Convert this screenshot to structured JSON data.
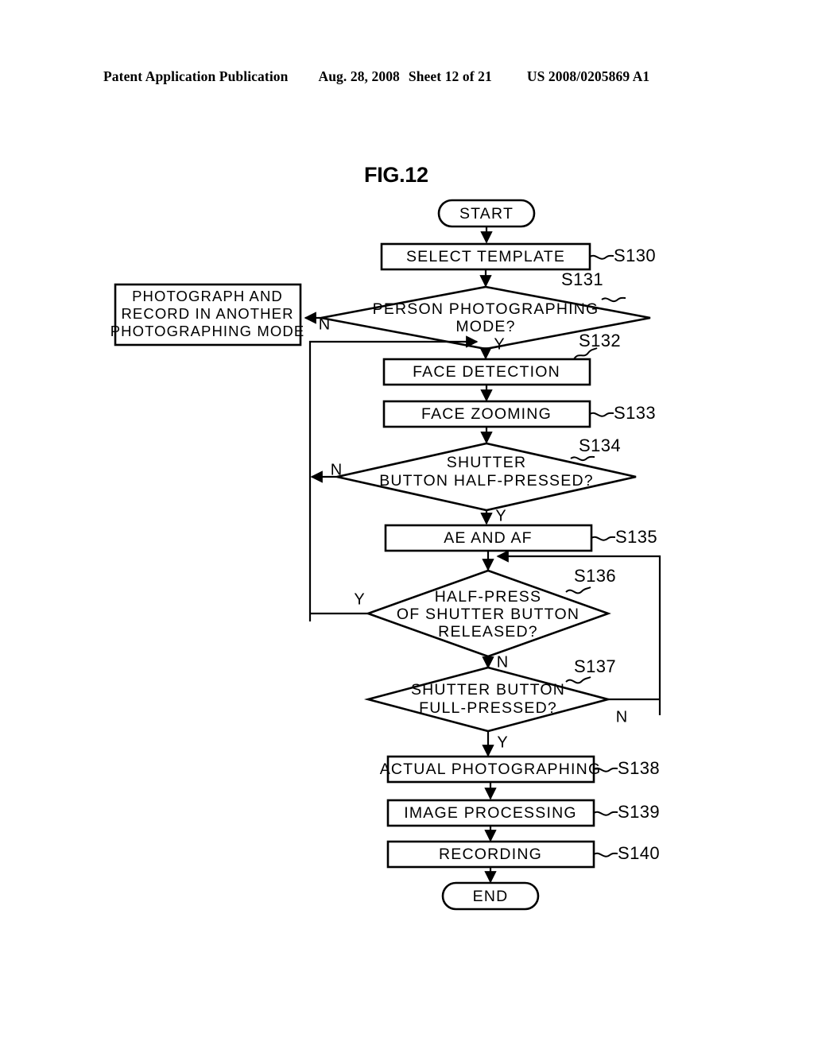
{
  "header": {
    "publication": "Patent Application Publication",
    "date": "Aug. 28, 2008",
    "sheet": "Sheet 12 of 21",
    "patent_number": "US 2008/0205869 A1"
  },
  "figure": {
    "title": "FIG.12"
  },
  "chart_data": {
    "type": "diagram",
    "diagram_type": "flowchart",
    "title": "FIG.12",
    "nodes": [
      {
        "id": "start",
        "shape": "terminator",
        "label": "START",
        "step": ""
      },
      {
        "id": "s130",
        "shape": "process",
        "label": "SELECT TEMPLATE",
        "step": "S130"
      },
      {
        "id": "s131",
        "shape": "decision",
        "label": "PERSON PHOTOGRAPHING MODE?",
        "step": "S131"
      },
      {
        "id": "altmode",
        "shape": "process",
        "label": "PHOTOGRAPH AND RECORD IN ANOTHER PHOTOGRAPHING MODE",
        "step": ""
      },
      {
        "id": "s132",
        "shape": "process",
        "label": "FACE DETECTION",
        "step": "S132"
      },
      {
        "id": "s133",
        "shape": "process",
        "label": "FACE ZOOMING",
        "step": "S133"
      },
      {
        "id": "s134",
        "shape": "decision",
        "label": "SHUTTER BUTTON HALF-PRESSED?",
        "step": "S134"
      },
      {
        "id": "s135",
        "shape": "process",
        "label": "AE AND AF",
        "step": "S135"
      },
      {
        "id": "s136",
        "shape": "decision",
        "label": "HALF-PRESS OF SHUTTER BUTTON RELEASED?",
        "step": "S136"
      },
      {
        "id": "s137",
        "shape": "decision",
        "label": "SHUTTER BUTTON FULL-PRESSED?",
        "step": "S137"
      },
      {
        "id": "s138",
        "shape": "process",
        "label": "ACTUAL PHOTOGRAPHING",
        "step": "S138"
      },
      {
        "id": "s139",
        "shape": "process",
        "label": "IMAGE PROCESSING",
        "step": "S139"
      },
      {
        "id": "s140",
        "shape": "process",
        "label": "RECORDING",
        "step": "S140"
      },
      {
        "id": "end",
        "shape": "terminator",
        "label": "END",
        "step": ""
      }
    ],
    "node_lines": {
      "start": [
        "START"
      ],
      "s130": [
        "SELECT TEMPLATE"
      ],
      "s131": [
        "PERSON PHOTOGRAPHING",
        "MODE?"
      ],
      "altmode": [
        "PHOTOGRAPH AND",
        "RECORD IN ANOTHER",
        "PHOTOGRAPHING MODE"
      ],
      "s132": [
        "FACE DETECTION"
      ],
      "s133": [
        "FACE ZOOMING"
      ],
      "s134": [
        "SHUTTER",
        "BUTTON HALF-PRESSED?"
      ],
      "s135": [
        "AE AND AF"
      ],
      "s136": [
        "HALF-PRESS",
        "OF SHUTTER BUTTON",
        "RELEASED?"
      ],
      "s137": [
        "SHUTTER BUTTON",
        "FULL-PRESSED?"
      ],
      "s138": [
        "ACTUAL PHOTOGRAPHING"
      ],
      "s139": [
        "IMAGE PROCESSING"
      ],
      "s140": [
        "RECORDING"
      ],
      "end": [
        "END"
      ]
    },
    "step_labels": [
      "S130",
      "S131",
      "S132",
      "S133",
      "S134",
      "S135",
      "S136",
      "S137",
      "S138",
      "S139",
      "S140"
    ],
    "edges": [
      {
        "from": "start",
        "to": "s130",
        "label": ""
      },
      {
        "from": "s130",
        "to": "s131",
        "label": ""
      },
      {
        "from": "s131",
        "to": "altmode",
        "label": "N"
      },
      {
        "from": "s131",
        "to": "s132",
        "label": "Y"
      },
      {
        "from": "s132",
        "to": "s133",
        "label": ""
      },
      {
        "from": "s133",
        "to": "s134",
        "label": ""
      },
      {
        "from": "s134",
        "to": "s132",
        "label": "N"
      },
      {
        "from": "s134",
        "to": "s135",
        "label": "Y"
      },
      {
        "from": "s135",
        "to": "s136",
        "label": ""
      },
      {
        "from": "s136",
        "to": "s132",
        "label": "Y"
      },
      {
        "from": "s136",
        "to": "s137",
        "label": "N"
      },
      {
        "from": "s137",
        "to": "s136",
        "label": "N"
      },
      {
        "from": "s137",
        "to": "s138",
        "label": "Y"
      },
      {
        "from": "s138",
        "to": "s139",
        "label": ""
      },
      {
        "from": "s139",
        "to": "s140",
        "label": ""
      },
      {
        "from": "s140",
        "to": "end",
        "label": ""
      }
    ],
    "branch_labels": {
      "s131_n": "N",
      "s131_y": "Y",
      "s134_n": "N",
      "s134_y": "Y",
      "s136_y": "Y",
      "s136_n": "N",
      "s137_n": "N",
      "s137_y": "Y"
    },
    "colors": {
      "stroke": "#000000",
      "fill": "#ffffff",
      "background": "#ffffff"
    }
  }
}
